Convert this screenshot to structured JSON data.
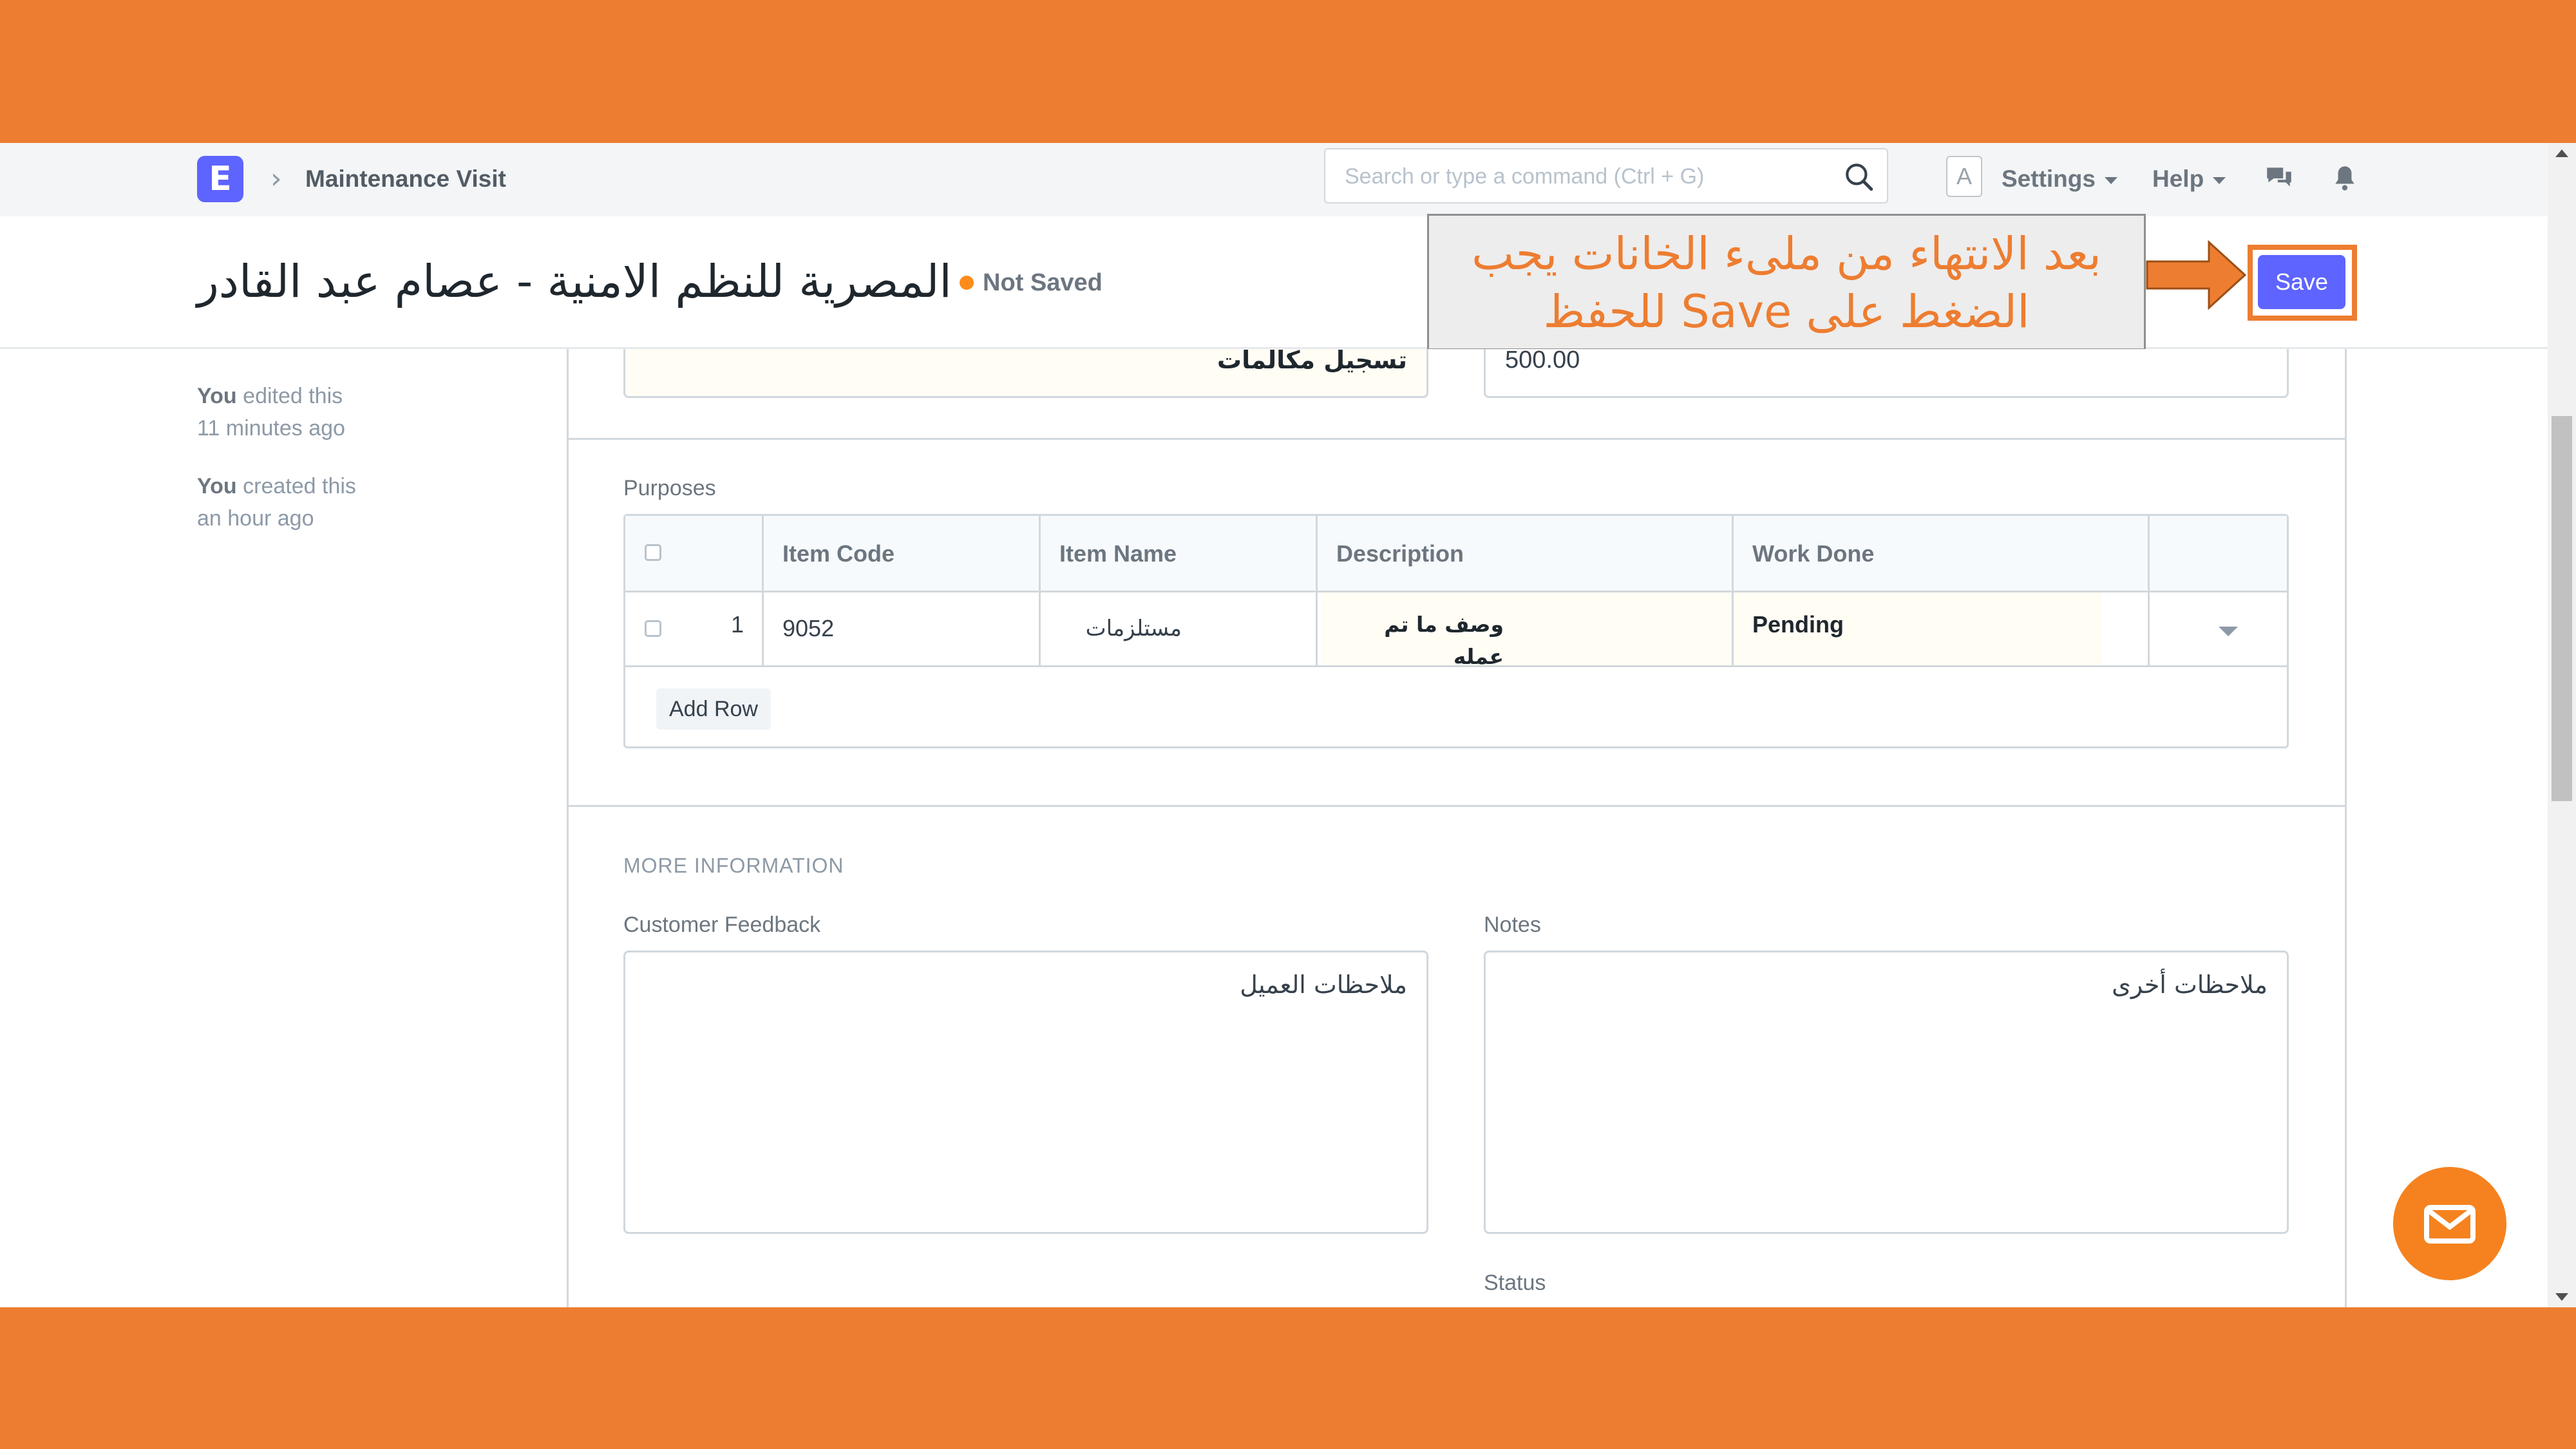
{
  "navbar": {
    "logo_letter": "E",
    "breadcrumb": "Maintenance Visit",
    "search_placeholder": "Search or type a command (Ctrl + G)",
    "avatar_letter": "A",
    "settings_label": "Settings",
    "help_label": "Help"
  },
  "page": {
    "title": "المصرية للنظم الامنية - عصام عبد القادر",
    "status": "Not Saved",
    "save_label": "Save"
  },
  "callout": {
    "text": "بعد الانتهاء من ملىء الخانات يجب الضغط على Save للحفظ"
  },
  "sidebar": {
    "edited_user": "You",
    "edited_text": "edited this",
    "edited_time": "11 minutes ago",
    "created_user": "You",
    "created_text": "created this",
    "created_time": "an hour ago"
  },
  "form": {
    "top_left_value": "تسجيل مكالمات",
    "top_right_value": "500.00",
    "purposes_label": "Purposes",
    "table": {
      "headers": [
        "Item Code",
        "Item Name",
        "Description",
        "Work Done"
      ],
      "rows": [
        {
          "idx": "1",
          "item_code": "9052",
          "item_name": "مستلزمات",
          "description": "وصف ما تم عمله",
          "work_done": "Pending"
        }
      ],
      "add_row_label": "Add Row"
    },
    "more_info_heading": "MORE INFORMATION",
    "customer_feedback_label": "Customer Feedback",
    "customer_feedback_value": "ملاحظات العميل",
    "notes_label": "Notes",
    "notes_value": "ملاحظات أخرى",
    "status_label": "Status"
  },
  "colors": {
    "frame_orange": "#ed7d31",
    "primary": "#5e64ff",
    "indicator_orange": "#ff8c1a"
  }
}
